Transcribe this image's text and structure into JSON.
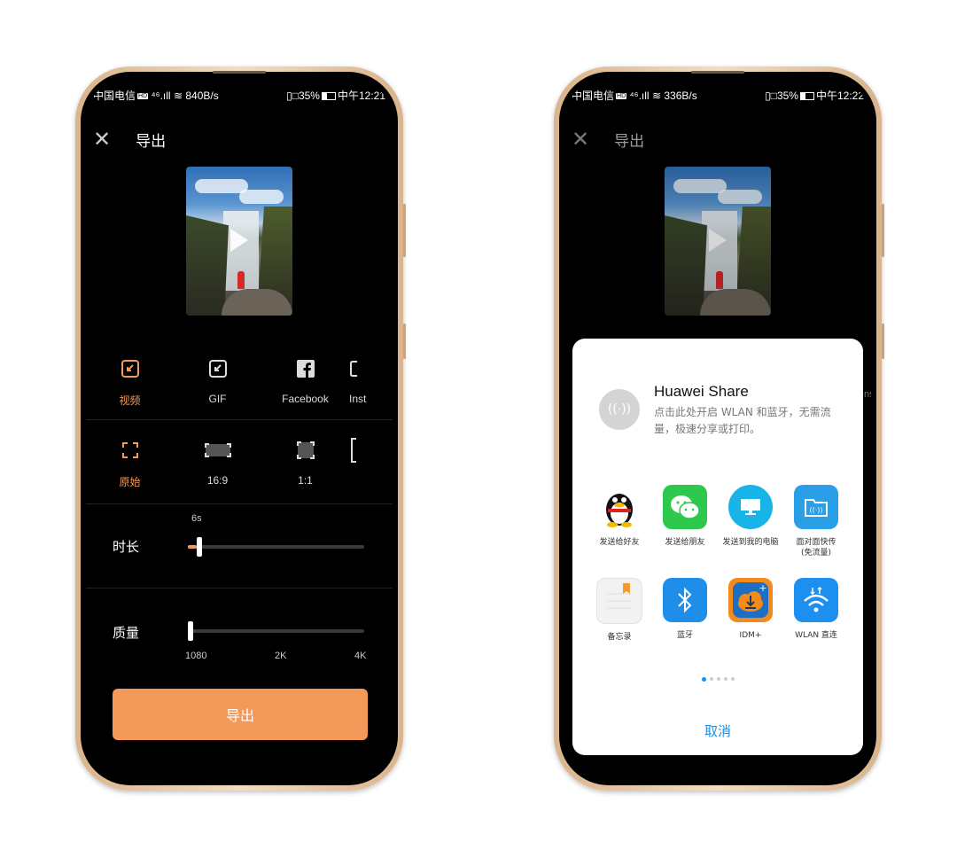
{
  "left_phone": {
    "status": {
      "carrier": "中国电信",
      "net": "⁴⁶.ıll",
      "speed": "840B/s",
      "vibrate": "▯□",
      "battery": "35%",
      "time": "中午12:21"
    },
    "title": "导出",
    "formats": [
      {
        "label": "视频"
      },
      {
        "label": "GIF"
      },
      {
        "label": "Facebook"
      },
      {
        "label": "Inst"
      }
    ],
    "ratios": [
      {
        "label": "原始"
      },
      {
        "label": "16:9"
      },
      {
        "label": "1:1"
      }
    ],
    "duration": {
      "label": "时长",
      "value": "6s",
      "fraction": 0.05
    },
    "quality": {
      "label": "质量",
      "ticks": [
        "1080",
        "2K",
        "4K"
      ],
      "fraction": 0.0
    },
    "export_button": "导出"
  },
  "right_phone": {
    "status": {
      "carrier": "中国电信",
      "net": "⁴⁶.ıll",
      "speed": "336B/s",
      "vibrate": "▯□",
      "battery": "35%",
      "time": "中午12:22"
    },
    "title": "导出",
    "partial_label": "nst",
    "share": {
      "title": "Huawei Share",
      "desc": "点击此处开启 WLAN 和蓝牙，无需流量，极速分享或打印。",
      "apps": [
        {
          "label": "发送给好友",
          "icon": "qq-penguin-icon",
          "color": "#ffffff"
        },
        {
          "label": "发送给朋友",
          "icon": "wechat-icon",
          "color": "#2dc84d"
        },
        {
          "label": "发送到我的电脑",
          "icon": "computer-icon",
          "color": "#18b4e8"
        },
        {
          "label": "面对面快传\n(免流量)",
          "icon": "face-to-face-icon",
          "color": "#2b9ee8"
        },
        {
          "label": "备忘录",
          "icon": "notepad-icon",
          "color": "#f2f2f2"
        },
        {
          "label": "蓝牙",
          "icon": "bluetooth-icon",
          "color": "#1f8ee8"
        },
        {
          "label": "IDM+",
          "icon": "idm-download-icon",
          "color": "#f28a1c"
        },
        {
          "label": "WLAN 直连",
          "icon": "wifi-direct-icon",
          "color": "#1c8ff0"
        }
      ],
      "page_dots": 5,
      "cancel": "取消"
    }
  },
  "colors": {
    "accent": "#f39a5b",
    "link": "#1a8fe3",
    "phone_gold": "#e9c9a4"
  }
}
